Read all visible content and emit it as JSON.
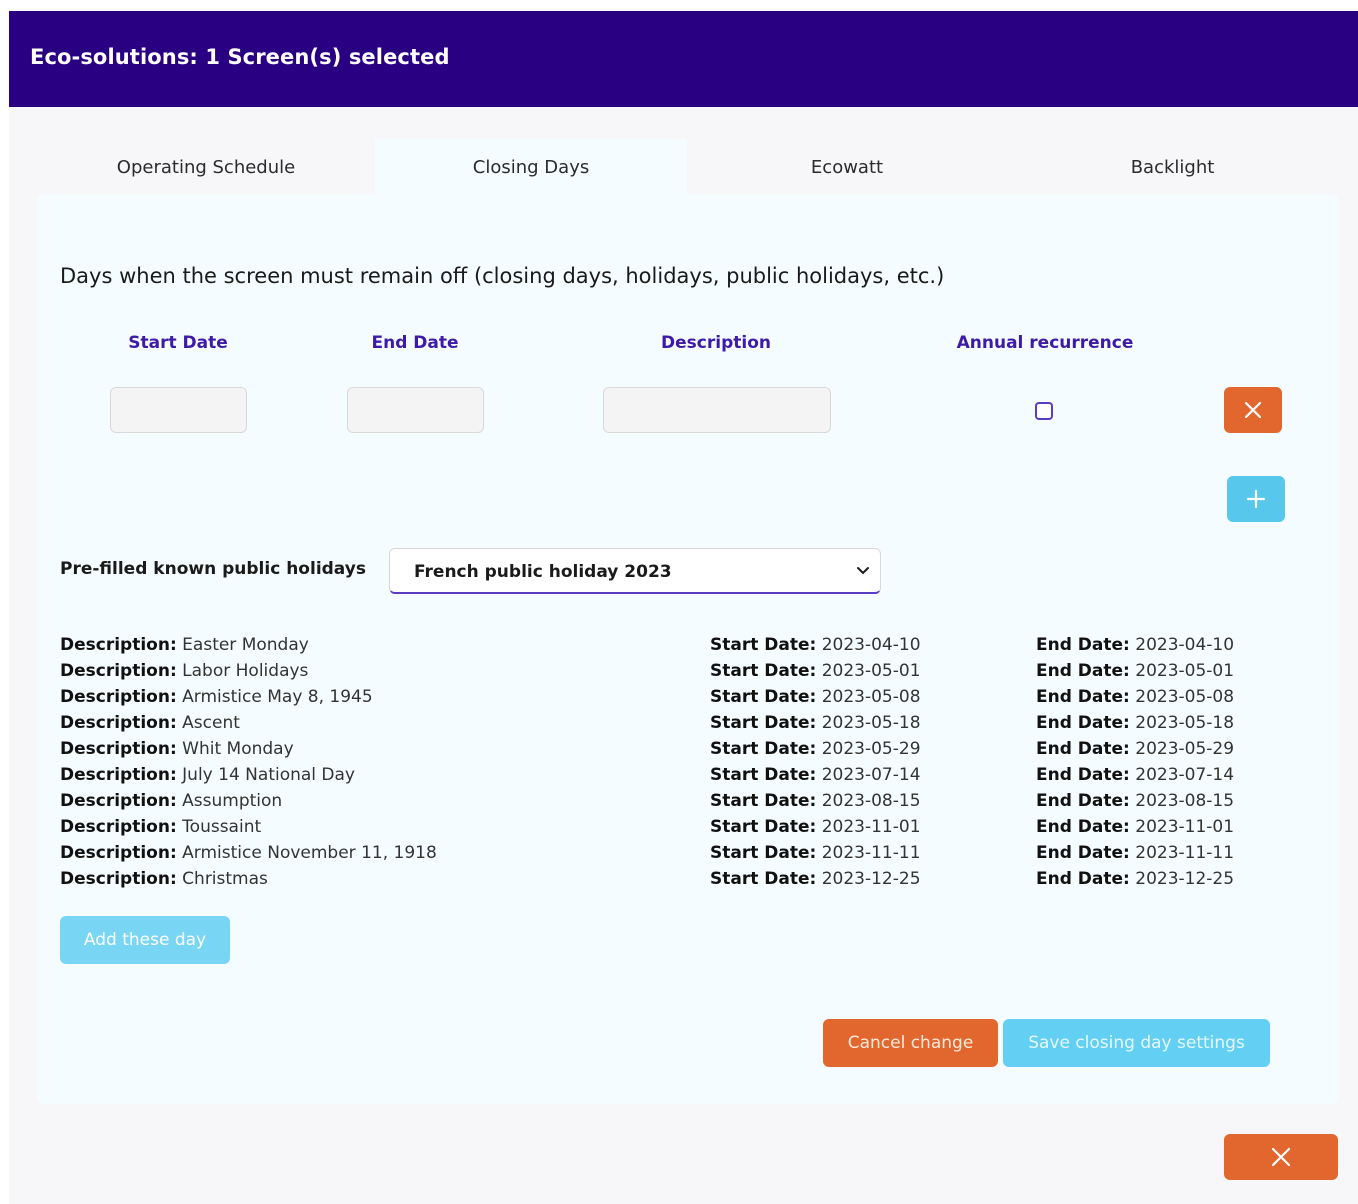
{
  "header": {
    "title": "Eco-solutions: 1 Screen(s) selected"
  },
  "tabs": [
    {
      "label": "Operating Schedule",
      "active": false
    },
    {
      "label": "Closing Days",
      "active": true
    },
    {
      "label": "Ecowatt",
      "active": false
    },
    {
      "label": "Backlight",
      "active": false
    }
  ],
  "panel": {
    "title": "Days when the screen must remain off (closing days, holidays, public holidays, etc.)",
    "columns": {
      "start_date": "Start Date",
      "end_date": "End Date",
      "description": "Description",
      "annual_recurrence": "Annual recurrence"
    },
    "entry": {
      "start_date": "",
      "end_date": "",
      "description": "",
      "annual_recurrence": false
    },
    "icons": {
      "delete": "close-icon",
      "add": "plus-icon",
      "dropdown": "chevron-down-icon"
    },
    "prefill": {
      "label": "Pre-filled known public holidays",
      "selected": "French public holiday 2023"
    },
    "field_labels": {
      "description": "Description:",
      "start_date": "Start Date:",
      "end_date": "End Date:"
    },
    "holidays": [
      {
        "description": "Easter Monday",
        "start": "2023-04-10",
        "end": "2023-04-10"
      },
      {
        "description": "Labor Holidays",
        "start": "2023-05-01",
        "end": "2023-05-01"
      },
      {
        "description": "Armistice May 8, 1945",
        "start": "2023-05-08",
        "end": "2023-05-08"
      },
      {
        "description": "Ascent",
        "start": "2023-05-18",
        "end": "2023-05-18"
      },
      {
        "description": "Whit Monday",
        "start": "2023-05-29",
        "end": "2023-05-29"
      },
      {
        "description": "July 14 National Day",
        "start": "2023-07-14",
        "end": "2023-07-14"
      },
      {
        "description": "Assumption",
        "start": "2023-08-15",
        "end": "2023-08-15"
      },
      {
        "description": "Toussaint",
        "start": "2023-11-01",
        "end": "2023-11-01"
      },
      {
        "description": "Armistice November 11, 1918",
        "start": "2023-11-11",
        "end": "2023-11-11"
      },
      {
        "description": "Christmas",
        "start": "2023-12-25",
        "end": "2023-12-25"
      }
    ],
    "add_days_label": "Add these day",
    "cancel_label": "Cancel change",
    "save_label": "Save closing day settings"
  },
  "footer": {
    "close_icon": "close-icon"
  },
  "colors": {
    "header_bg": "#2a0082",
    "accent_purple": "#3d1aa8",
    "orange": "#e2672e",
    "cyan": "#58c7ec"
  }
}
